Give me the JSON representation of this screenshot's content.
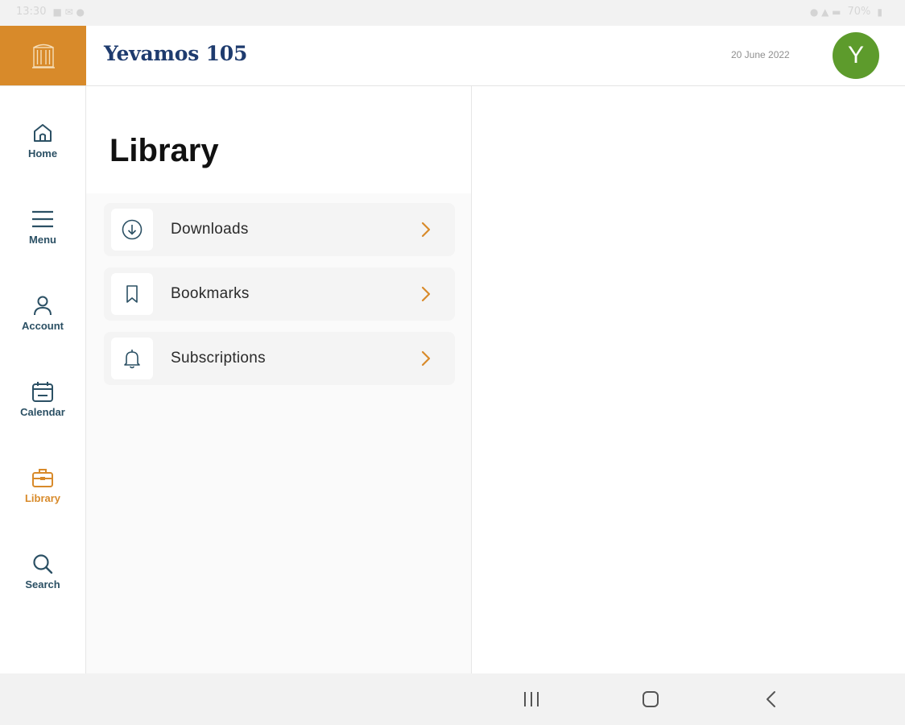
{
  "status_bar": {
    "time": "13:30",
    "battery": "70%"
  },
  "header": {
    "title": "Yevamos 105",
    "date": "20 June 2022",
    "avatar_initial": "Y"
  },
  "colors": {
    "brand_orange": "#d88a2a",
    "title_navy": "#1e3b6e",
    "nav_teal": "#2b5064",
    "avatar_green": "#5d9b2c"
  },
  "nav": {
    "items": [
      {
        "label": "Home",
        "icon": "home-icon",
        "active": false
      },
      {
        "label": "Menu",
        "icon": "hamburger-icon",
        "active": false
      },
      {
        "label": "Account",
        "icon": "person-icon",
        "active": false
      },
      {
        "label": "Calendar",
        "icon": "calendar-icon",
        "active": false
      },
      {
        "label": "Library",
        "icon": "briefcase-icon",
        "active": true
      },
      {
        "label": "Search",
        "icon": "search-icon",
        "active": false
      }
    ]
  },
  "library": {
    "title": "Library",
    "items": [
      {
        "label": "Downloads",
        "icon": "download-icon"
      },
      {
        "label": "Bookmarks",
        "icon": "bookmark-icon"
      },
      {
        "label": "Subscriptions",
        "icon": "bell-icon"
      }
    ]
  }
}
